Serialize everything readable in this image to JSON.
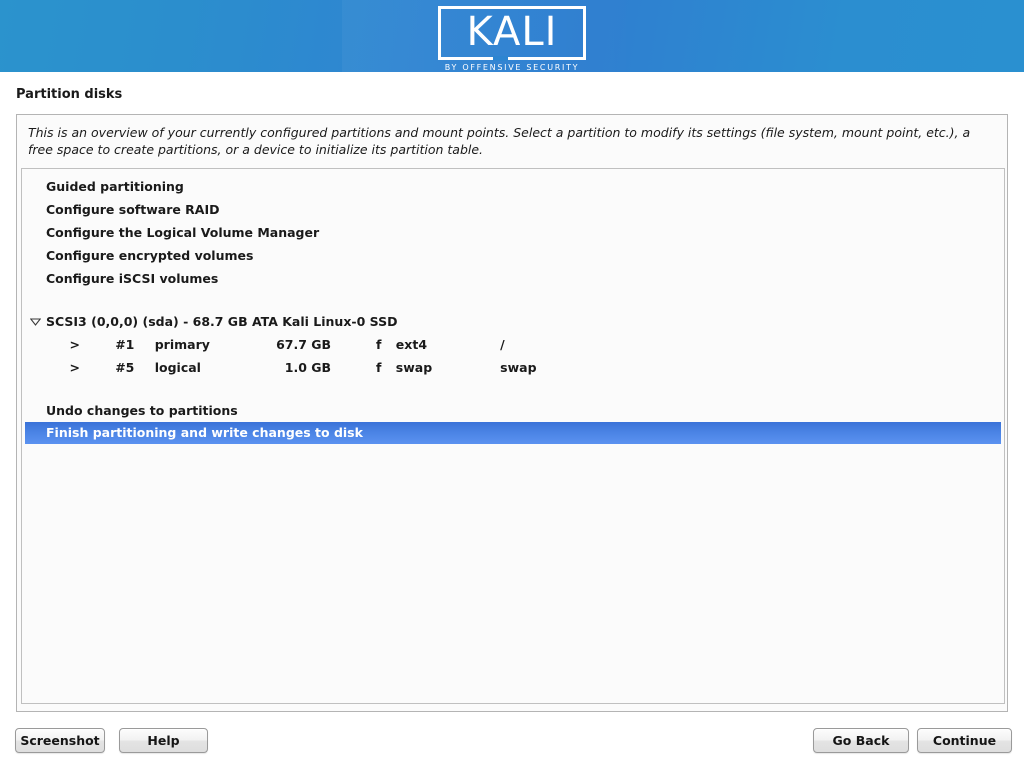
{
  "banner": {
    "logo_text": "KALI",
    "logo_tagline": "BY OFFENSIVE SECURITY",
    "gradient_left": "#2b93cd",
    "gradient_right": "#2a90d0"
  },
  "page": {
    "title": "Partition disks",
    "description": "This is an overview of your currently configured partitions and mount points. Select a partition to modify its settings (file system, mount point, etc.), a free space to create partitions, or a device to initialize its partition table."
  },
  "menu": {
    "items": [
      {
        "label": "Guided partitioning"
      },
      {
        "label": "Configure software RAID"
      },
      {
        "label": "Configure the Logical Volume Manager"
      },
      {
        "label": "Configure encrypted volumes"
      },
      {
        "label": "Configure iSCSI volumes"
      }
    ]
  },
  "device": {
    "disclosure_icon": "triangle-down-icon",
    "label": "SCSI3 (0,0,0) (sda) - 68.7 GB ATA Kali Linux-0 SSD",
    "partitions": [
      {
        "marker": ">",
        "number": "#1",
        "type": "primary",
        "size": "67.7 GB",
        "flag": "f",
        "filesystem": "ext4",
        "mountpoint": "/"
      },
      {
        "marker": ">",
        "number": "#5",
        "type": "logical",
        "size": "1.0 GB",
        "flag": "f",
        "filesystem": "swap",
        "mountpoint": "swap"
      }
    ]
  },
  "actions": {
    "undo_label": "Undo changes to partitions",
    "finish_label": "Finish partitioning and write changes to disk",
    "selected": "finish",
    "selection_color": "#4a83e4"
  },
  "footer": {
    "screenshot_label": "Screenshot",
    "help_label": "Help",
    "go_back_label": "Go Back",
    "continue_label": "Continue"
  }
}
